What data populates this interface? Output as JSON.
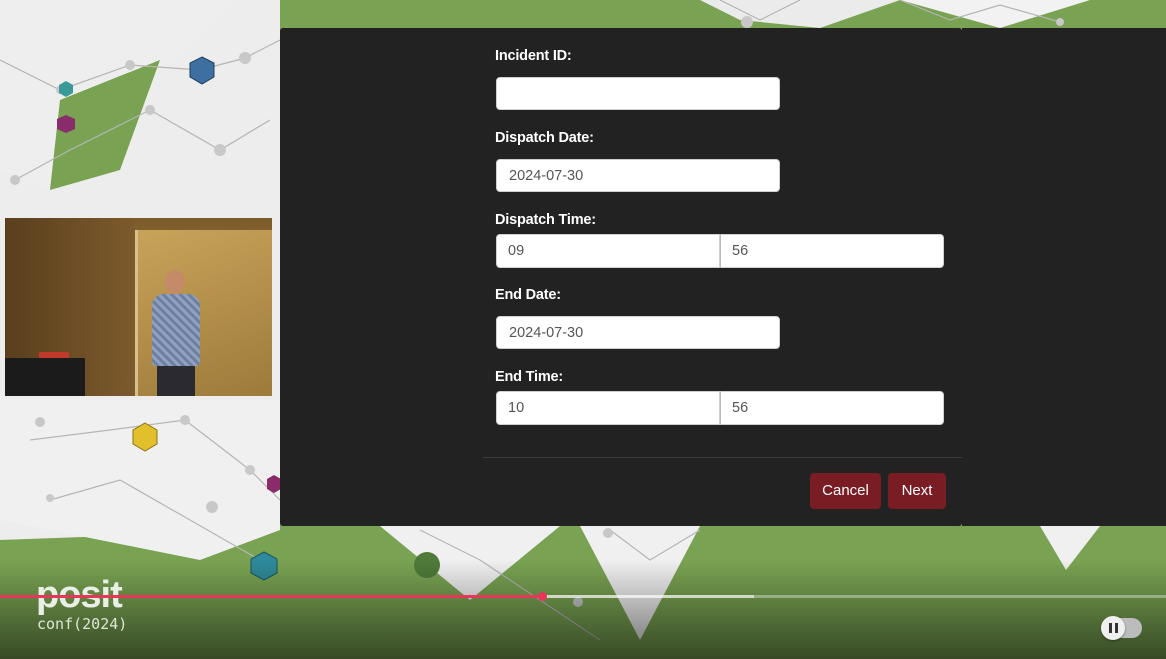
{
  "form": {
    "incident_id": {
      "label": "Incident ID:",
      "value": ""
    },
    "dispatch_date": {
      "label": "Dispatch Date:",
      "value": "2024-07-30"
    },
    "dispatch_time": {
      "label": "Dispatch Time:",
      "hour": "09",
      "minute": "56"
    },
    "end_date": {
      "label": "End Date:",
      "value": "2024-07-30"
    },
    "end_time": {
      "label": "End Time:",
      "hour": "10",
      "minute": "56"
    }
  },
  "buttons": {
    "cancel": "Cancel",
    "next": "Next"
  },
  "branding": {
    "logo": "posit",
    "subtitle": "conf(2024)"
  },
  "player": {
    "progress_played": 0.465,
    "progress_buffered": 0.647,
    "state": "pause-toggle"
  },
  "colors": {
    "accent_button": "#7a1c24",
    "modal_bg": "#222222",
    "progress": "#e8365b",
    "background_green": "#79a352"
  }
}
